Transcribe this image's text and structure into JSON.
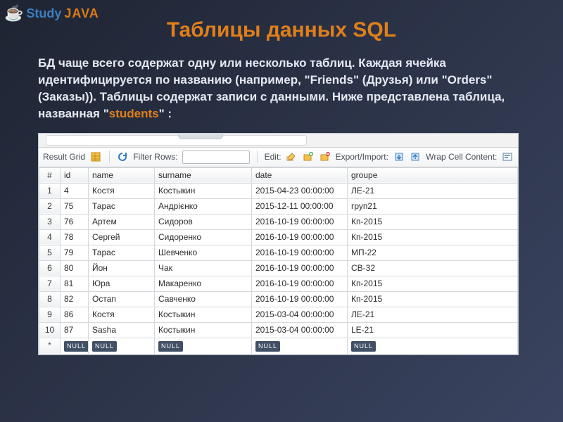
{
  "logo": {
    "cup": "☕",
    "study": "Study",
    "java": "JAVA"
  },
  "title": "Таблицы данных SQL",
  "intro_before": "БД чаще всего содержат одну или несколько таблиц. Каждая ячейка идентифицируется по названию (например, \"Friends\" (Друзья) или \"Orders\" (Заказы)). Таблицы содержат записи с данными. Ниже представлена таблица, названная \"",
  "intro_hl": "students",
  "intro_after": "\" :",
  "toolbar": {
    "result_grid": "Result Grid",
    "filter_rows": "Filter Rows:",
    "filter_placeholder": "",
    "edit": "Edit:",
    "export": "Export/Import:",
    "wrap": "Wrap Cell Content:"
  },
  "columns": {
    "rownum": "#",
    "id": "id",
    "name": "name",
    "surname": "surname",
    "date": "date",
    "groupe": "groupe"
  },
  "null_label": "NULL",
  "star_label": "*",
  "rows": [
    {
      "n": "1",
      "id": "4",
      "name": "Костя",
      "surname": "Костыкин",
      "date": "2015-04-23 00:00:00",
      "groupe": "ЛЕ-21"
    },
    {
      "n": "2",
      "id": "75",
      "name": "Тарас",
      "surname": "Андрієнко",
      "date": "2015-12-11 00:00:00",
      "groupe": "груп21"
    },
    {
      "n": "3",
      "id": "76",
      "name": "Артем",
      "surname": "Сидоров",
      "date": "2016-10-19 00:00:00",
      "groupe": "Кп-2015"
    },
    {
      "n": "4",
      "id": "78",
      "name": "Сергей",
      "surname": "Сидоренко",
      "date": "2016-10-19 00:00:00",
      "groupe": "Кп-2015"
    },
    {
      "n": "5",
      "id": "79",
      "name": "Тарас",
      "surname": "Шевченко",
      "date": "2016-10-19 00:00:00",
      "groupe": "МП-22"
    },
    {
      "n": "6",
      "id": "80",
      "name": "Йон",
      "surname": "Чак",
      "date": "2016-10-19 00:00:00",
      "groupe": "СВ-32"
    },
    {
      "n": "7",
      "id": "81",
      "name": "Юра",
      "surname": "Макаренко",
      "date": "2016-10-19 00:00:00",
      "groupe": "Кп-2015"
    },
    {
      "n": "8",
      "id": "82",
      "name": "Остап",
      "surname": "Савченко",
      "date": "2016-10-19 00:00:00",
      "groupe": "Кп-2015"
    },
    {
      "n": "9",
      "id": "86",
      "name": "Костя",
      "surname": "Костыкин",
      "date": "2015-03-04 00:00:00",
      "groupe": "ЛЕ-21"
    },
    {
      "n": "10",
      "id": "87",
      "name": "Sasha",
      "surname": "Костыкин",
      "date": "2015-03-04 00:00:00",
      "groupe": "LE-21"
    }
  ]
}
